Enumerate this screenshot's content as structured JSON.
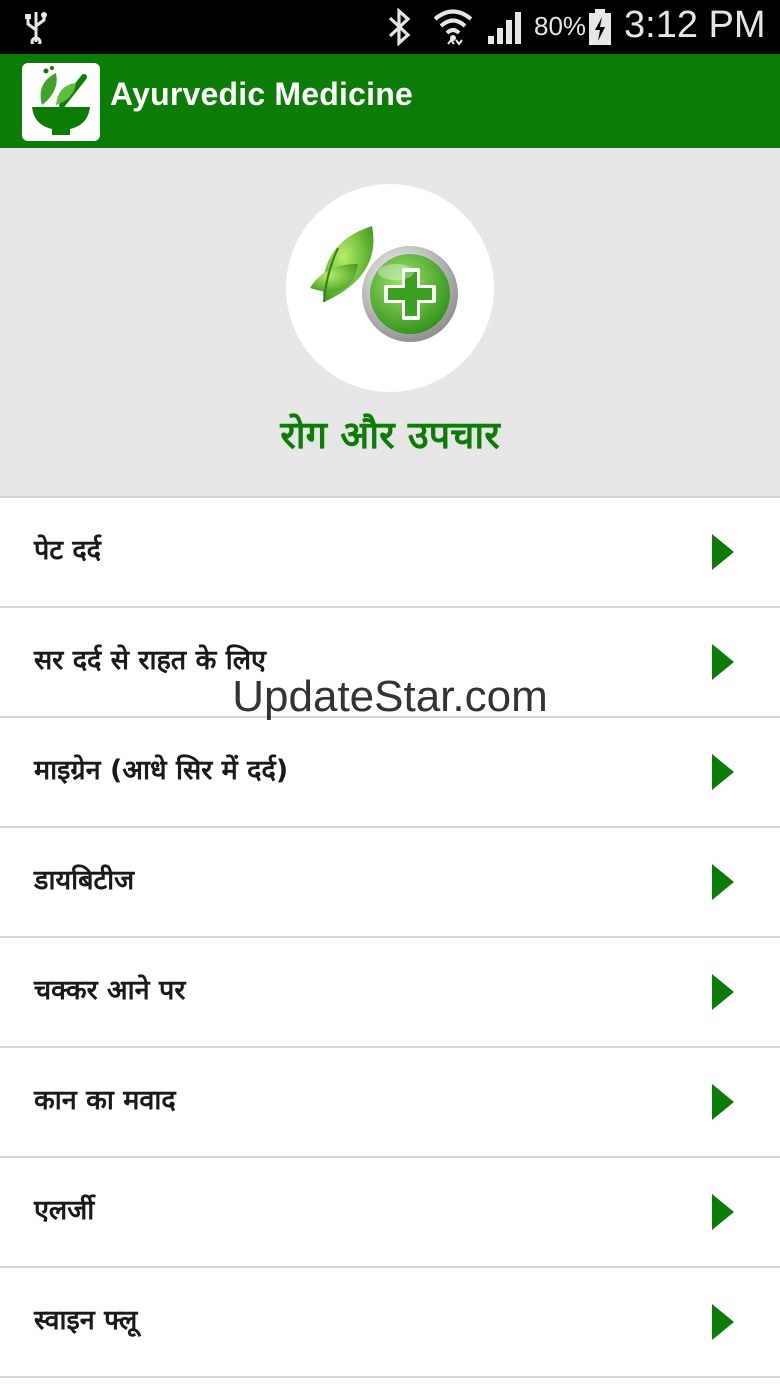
{
  "status_bar": {
    "battery_percent": "80%",
    "time": "3:12 PM",
    "icons": [
      "usb-icon",
      "bluetooth-icon",
      "wifi-icon",
      "signal-icon",
      "battery-charging-icon"
    ]
  },
  "toolbar": {
    "title": "Ayurvedic Medicine",
    "logo_icon": "mortar-pestle-leaves-icon",
    "color": "#0b7d06"
  },
  "header": {
    "icon": "leaves-medical-cross-icon",
    "title": "रोग और उपचार"
  },
  "list": {
    "items": [
      {
        "label": "पेट दर्द"
      },
      {
        "label": "सर दर्द से राहत के लिए"
      },
      {
        "label": "माइग्रेन (आधे सिर में दर्द)"
      },
      {
        "label": "डायबिटीज"
      },
      {
        "label": "चक्कर आने पर"
      },
      {
        "label": "कान का मवाद"
      },
      {
        "label": "एलर्जी"
      },
      {
        "label": "स्वाइन फ्लू"
      }
    ],
    "arrow_icon": "chevron-right-icon"
  },
  "watermark": "UpdateStar.com",
  "colors": {
    "accent": "#0b7d06",
    "header_bg": "#e6e6e6",
    "divider": "#d6d6d6"
  }
}
